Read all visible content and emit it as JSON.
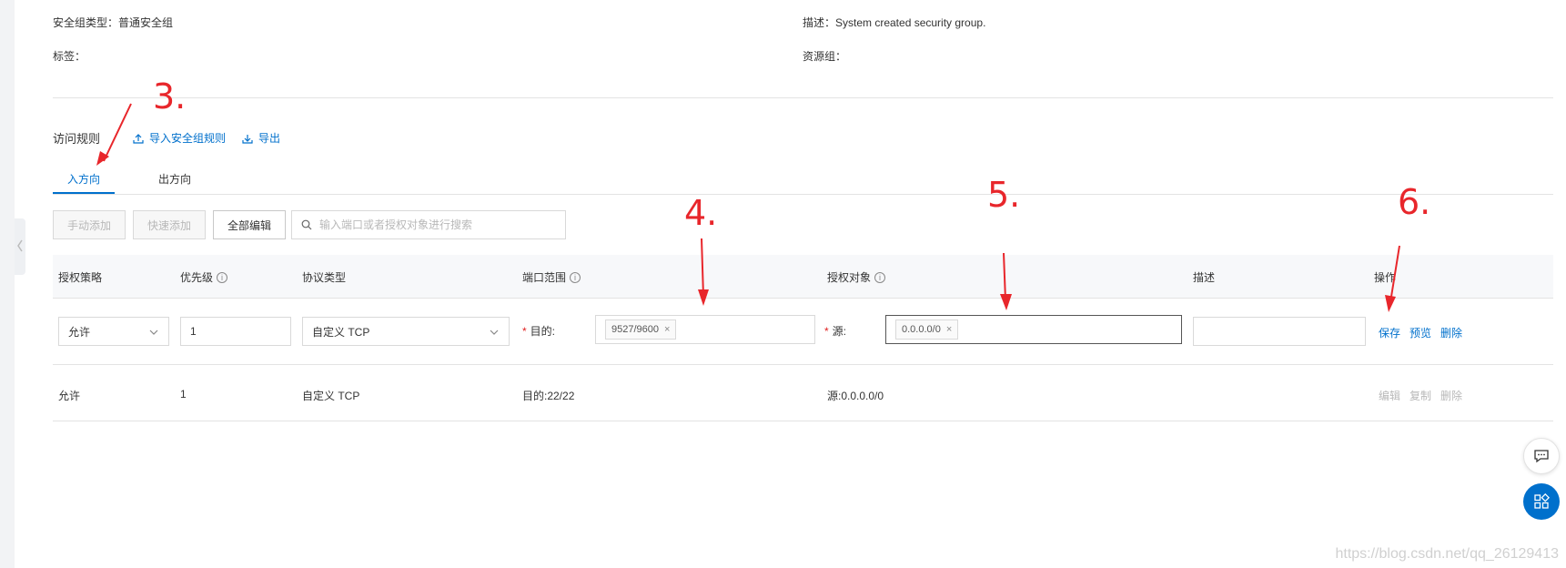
{
  "info": {
    "type_label": "安全组类型：普通安全组",
    "desc_label": "描述：System created security group.",
    "tags_label": "标签：",
    "resgroup_label": "资源组："
  },
  "section": {
    "title": "访问规则",
    "import_link": "导入安全组规则",
    "export_link": "导出"
  },
  "tabs": [
    {
      "label": "入方向",
      "active": true
    },
    {
      "label": "出方向",
      "active": false
    }
  ],
  "toolbar": {
    "manual_add": "手动添加",
    "quick_add": "快速添加",
    "edit_all": "全部编辑",
    "search_placeholder": "输入端口或者授权对象进行搜索"
  },
  "table": {
    "headers": [
      "授权策略",
      "优先级",
      "协议类型",
      "端口范围",
      "授权对象",
      "描述",
      "操作"
    ],
    "edit_row": {
      "policy": "允许",
      "priority": "1",
      "protocol": "自定义 TCP",
      "dest_label": "目的:",
      "dest_tag": "9527/9600",
      "source_label": "源:",
      "source_tag": "0.0.0.0/0",
      "description": "",
      "actions": [
        "保存",
        "预览",
        "删除"
      ]
    },
    "rows": [
      {
        "policy": "允许",
        "priority": "1",
        "protocol": "自定义 TCP",
        "port": "目的:22/22",
        "source": "源:0.0.0.0/0",
        "actions": [
          "编辑",
          "复制",
          "删除"
        ]
      }
    ]
  },
  "annotations": [
    "3.",
    "4.",
    "5.",
    "6."
  ],
  "annotation_color": "#e8262b",
  "accent_color": "#0070cc",
  "watermark": "https://blog.csdn.net/qq_26129413"
}
